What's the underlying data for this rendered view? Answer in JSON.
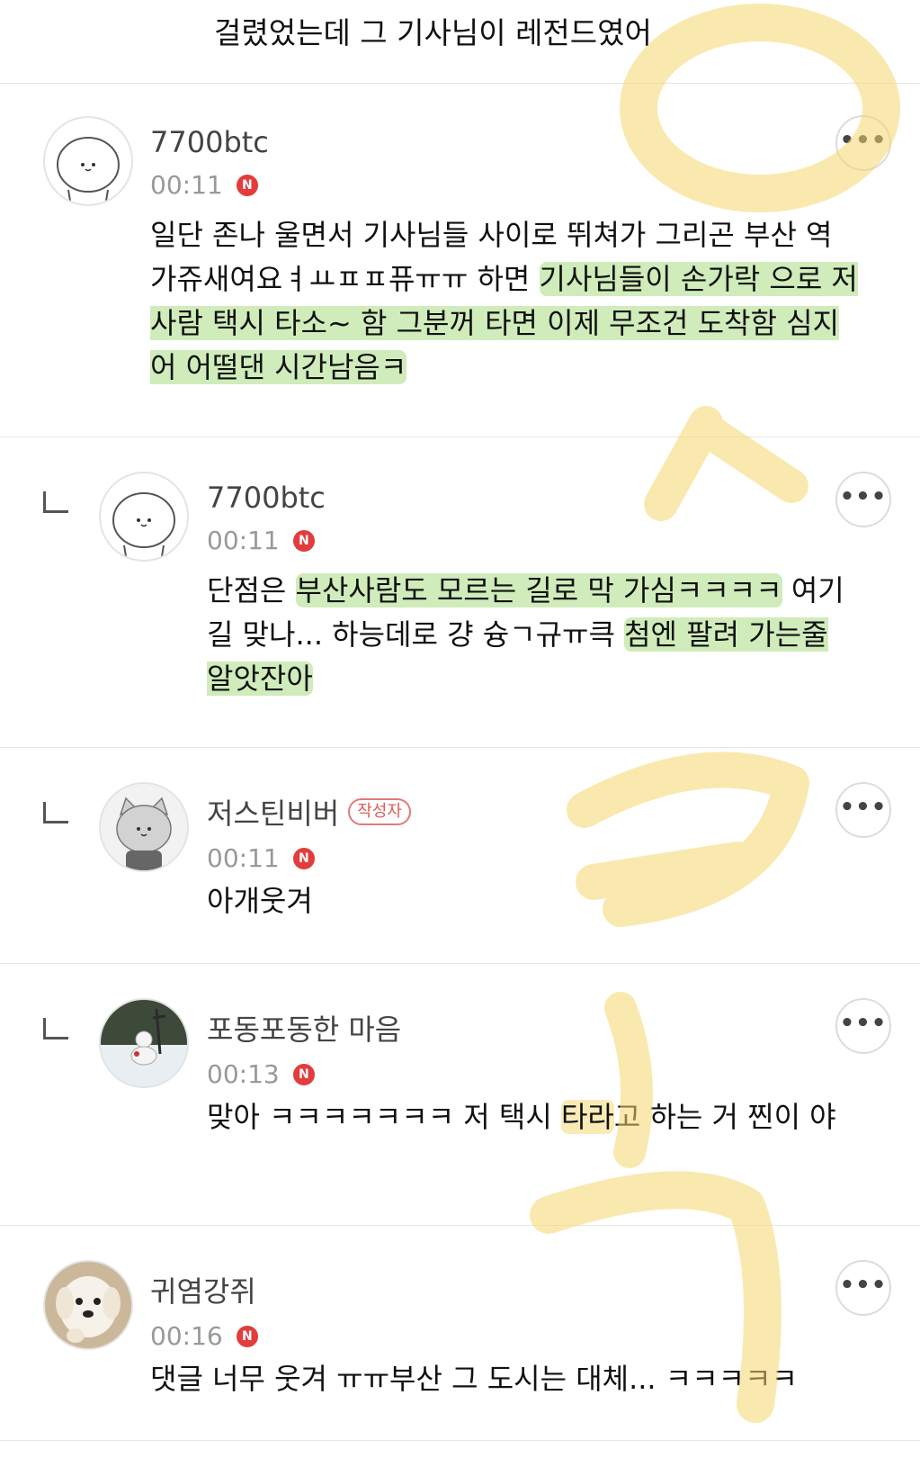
{
  "top_fragment": {
    "text": "걸렸었는데 그 기사님이 레전드였어"
  },
  "comments": [
    {
      "nickname": "7700btc",
      "time": "00:11",
      "new_badge": "N",
      "more_label": "•••",
      "avatar": "bear-face-icon",
      "is_reply": false,
      "body_plain_1": "일단 존나 울면서 기사님들 사이로 뛰쳐가 그리곤 부산 역 가쥬새여요ㅕㅛㅍㅍ퓨ㅠㅠ 하면 ",
      "body_hl_1": "기사님들이 손가락 으로 저사람 택시 타소~ 함 그분꺼 타면 이제 무조건 도착함 심지어 어떨댄 시간남음ㅋ"
    },
    {
      "nickname": "7700btc",
      "time": "00:11",
      "new_badge": "N",
      "more_label": "•••",
      "avatar": "bear-face-icon",
      "is_reply": true,
      "body_plain_1": "단점은 ",
      "body_hl_1": "부산사람도 모르는 길로 막 가심ㅋㅋㅋㅋ",
      "body_plain_2": " 여기 길 맞나... 하능데로 걍 슝ㄱ규ㅠ큭 ",
      "body_hl_2": "첨엔 팔려 가는줄 알앗잔아"
    },
    {
      "nickname": "저스틴비버",
      "author_badge": "작성자",
      "time": "00:11",
      "new_badge": "N",
      "more_label": "•••",
      "avatar": "gray-cat-icon",
      "is_reply": true,
      "body": "아개웃겨"
    },
    {
      "nickname": "포동포동한 마음",
      "time": "00:13",
      "new_badge": "N",
      "more_label": "•••",
      "avatar": "snowman-photo-icon",
      "is_reply": true,
      "body_plain_1": "맞아 ㅋㅋㅋㅋㅋㅋㅋ 저 택시 ",
      "body_hl_1": "타라",
      "body_plain_2": "고 하는 거 찐이 야"
    },
    {
      "nickname": "귀염강쥐",
      "time": "00:16",
      "new_badge": "N",
      "more_label": "•••",
      "avatar": "puppy-photo-icon",
      "is_reply": false,
      "body": "댓글 너무 웃겨 ㅠㅠ부산 그 도시는 대체... ㅋㅋㅋㅋㅋ"
    }
  ],
  "colors": {
    "green_highlight": "#a8dc82",
    "yellow_doodle": "#f5d76e",
    "new_badge": "#e23c3c",
    "author_badge": "#e05a5a"
  }
}
